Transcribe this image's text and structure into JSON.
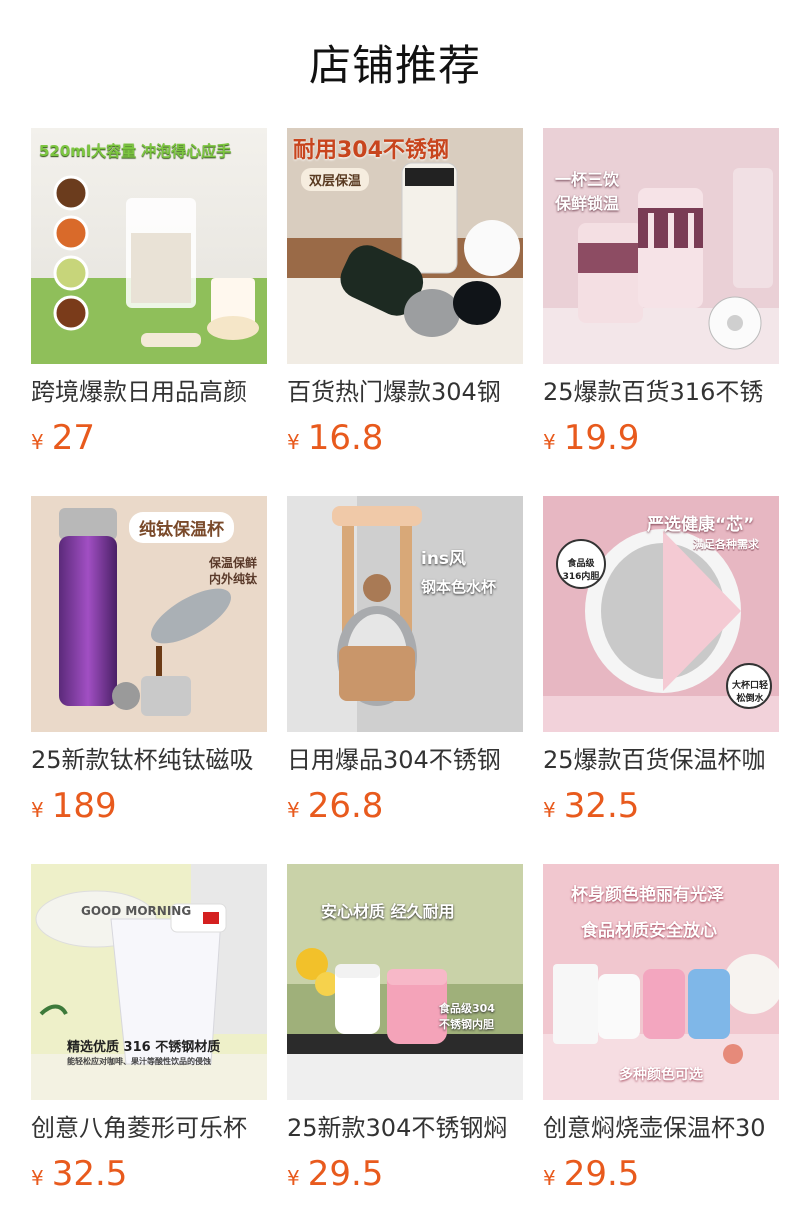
{
  "section": {
    "title": "店铺推荐"
  },
  "currency_symbol": "¥",
  "colors": {
    "price": "#e85a1d"
  },
  "products": [
    {
      "name": "跨境爆款日用品高颜",
      "price": "27",
      "image_text": [
        "520ml大容量 冲泡得心应手"
      ]
    },
    {
      "name": "百货热门爆款304钢",
      "price": "16.8",
      "image_text": [
        "耐用304不锈钢",
        "双层保温"
      ]
    },
    {
      "name": "25爆款百货316不锈",
      "price": "19.9",
      "image_text": [
        "一杯三饮",
        "保鲜锁温"
      ]
    },
    {
      "name": "25新款钛杯纯钛磁吸",
      "price": "189",
      "image_text": [
        "纯钛保温杯",
        "保温保鲜",
        "内外纯钛"
      ]
    },
    {
      "name": "日用爆品304不锈钢",
      "price": "26.8",
      "image_text": [
        "ins风",
        "钢本色水杯"
      ]
    },
    {
      "name": "25爆款百货保温杯咖",
      "price": "32.5",
      "image_text": [
        "严选健康“芯”",
        "满足各种需求",
        "食品级316内胆",
        "大杯口轻松倒水"
      ]
    },
    {
      "name": "创意八角菱形可乐杯",
      "price": "32.5",
      "image_text": [
        "GOOD MORNING",
        "精选优质 316 不锈钢材质",
        "能轻松应对咖啡、果汁等酸性饮品的侵蚀"
      ]
    },
    {
      "name": "25新款304不锈钢焖",
      "price": "29.5",
      "image_text": [
        "安心材质 经久耐用",
        "食品级304",
        "不锈钢内胆"
      ]
    },
    {
      "name": "创意焖烧壶保温杯30",
      "price": "29.5",
      "image_text": [
        "杯身颜色艳丽有光泽",
        "食品材质安全放心",
        "多种颜色可选"
      ]
    }
  ]
}
